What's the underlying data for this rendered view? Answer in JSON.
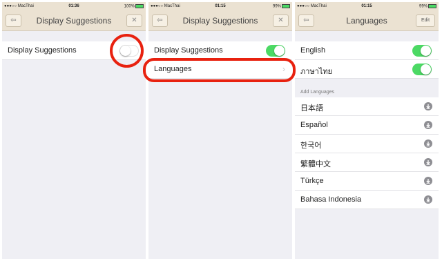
{
  "screens": [
    {
      "status": {
        "carrier": "●●●○○ MacThai",
        "time": "01:36",
        "battery": "100%",
        "battery_level": 1.0
      },
      "title": "Display Suggestions",
      "rows": [
        {
          "label": "Display Suggestions",
          "toggle_on": false
        }
      ]
    },
    {
      "status": {
        "carrier": "●●●○○ MacThai",
        "time": "01:15",
        "battery": "99%",
        "battery_level": 0.99
      },
      "title": "Display Suggestions",
      "rows": [
        {
          "label": "Display Suggestions",
          "toggle_on": true
        },
        {
          "label": "Languages"
        }
      ]
    },
    {
      "status": {
        "carrier": "●●●○○ MacThai",
        "time": "01:15",
        "battery": "99%",
        "battery_level": 0.99
      },
      "title": "Languages",
      "edit_label": "Edit",
      "installed": [
        {
          "label": "English",
          "toggle_on": true
        },
        {
          "label": "ภาษาไทย",
          "toggle_on": true
        }
      ],
      "section_header": "Add Languages",
      "available": [
        "日本語",
        "Español",
        "한국어",
        "繁體中文",
        "Türkçe",
        "Bahasa Indonesia"
      ]
    }
  ],
  "colors": {
    "accent_red": "#e8210f",
    "toggle_on": "#4cd964",
    "bar_bg": "#ebe2d2"
  },
  "icons": {
    "back": "back-arrow-icon",
    "close": "close-x-icon",
    "download": "download-icon",
    "chevron": "chevron-right-icon"
  }
}
